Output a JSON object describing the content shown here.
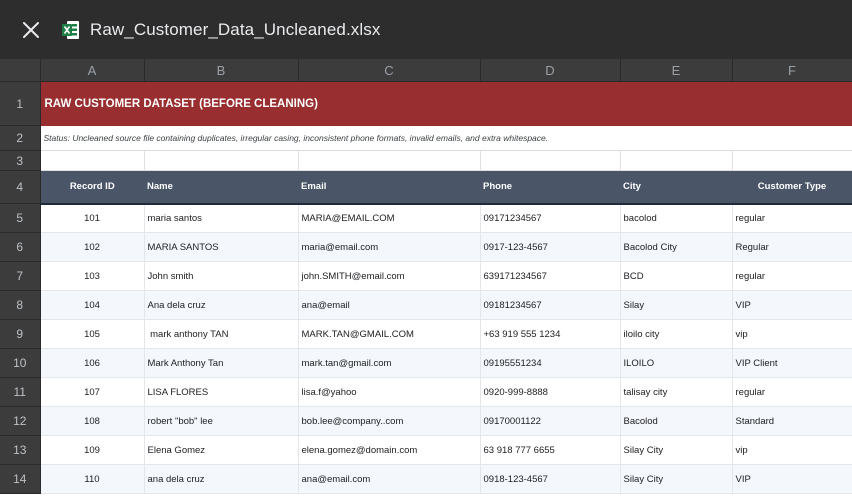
{
  "file": {
    "name": "Raw_Customer_Data_Uncleaned.xlsx",
    "icon": "excel-file-icon"
  },
  "columns": [
    "A",
    "B",
    "C",
    "D",
    "E",
    "F"
  ],
  "row_numbers": [
    "1",
    "2",
    "3",
    "4",
    "5",
    "6",
    "7",
    "8",
    "9",
    "10",
    "11",
    "12",
    "13",
    "14"
  ],
  "title": "RAW CUSTOMER DATASET (BEFORE CLEANING)",
  "status": "Status: Uncleaned source file containing duplicates, irregular casing, inconsistent phone formats, invalid emails, and extra whitespace.",
  "headers": [
    "Record ID",
    "Name",
    "Email",
    "Phone",
    "City",
    "Customer Type"
  ],
  "rows": [
    [
      "101",
      "maria santos",
      "MARIA@EMAIL.COM",
      "09171234567",
      "bacolod",
      "regular"
    ],
    [
      "102",
      "MARIA SANTOS",
      "maria@email.com",
      "0917-123-4567",
      "Bacolod City",
      "Regular"
    ],
    [
      "103",
      "John smith",
      "john.SMITH@email.com",
      "639171234567",
      "BCD",
      "regular"
    ],
    [
      "104",
      "Ana dela cruz",
      "ana@email",
      "09181234567",
      "Silay",
      "VIP"
    ],
    [
      "105",
      " mark anthony TAN",
      "MARK.TAN@GMAIL.COM",
      "+63 919 555 1234",
      "iloilo city",
      "vip"
    ],
    [
      "106",
      "Mark Anthony Tan",
      "mark.tan@gmail.com",
      "09195551234",
      "ILOILO",
      "VIP Client"
    ],
    [
      "107",
      "LISA FLORES",
      "lisa.f@yahoo",
      "0920-999-8888",
      "talisay city",
      "regular"
    ],
    [
      "108",
      "robert \"bob\" lee",
      "bob.lee@company..com",
      "09170001122",
      "Bacolod",
      "Standard"
    ],
    [
      "109",
      "Elena Gomez",
      "elena.gomez@domain.com",
      "63 918 777 6655",
      "Silay City",
      "vip"
    ],
    [
      "110",
      "ana dela cruz",
      "ana@email.com",
      "0918-123-4567",
      "Silay City",
      "VIP"
    ]
  ],
  "colors": {
    "title_bg": "#982e2f",
    "header_bg": "#4a5568",
    "toolbar_bg": "#2d2d2d",
    "excel_green": "#1e7e45"
  }
}
